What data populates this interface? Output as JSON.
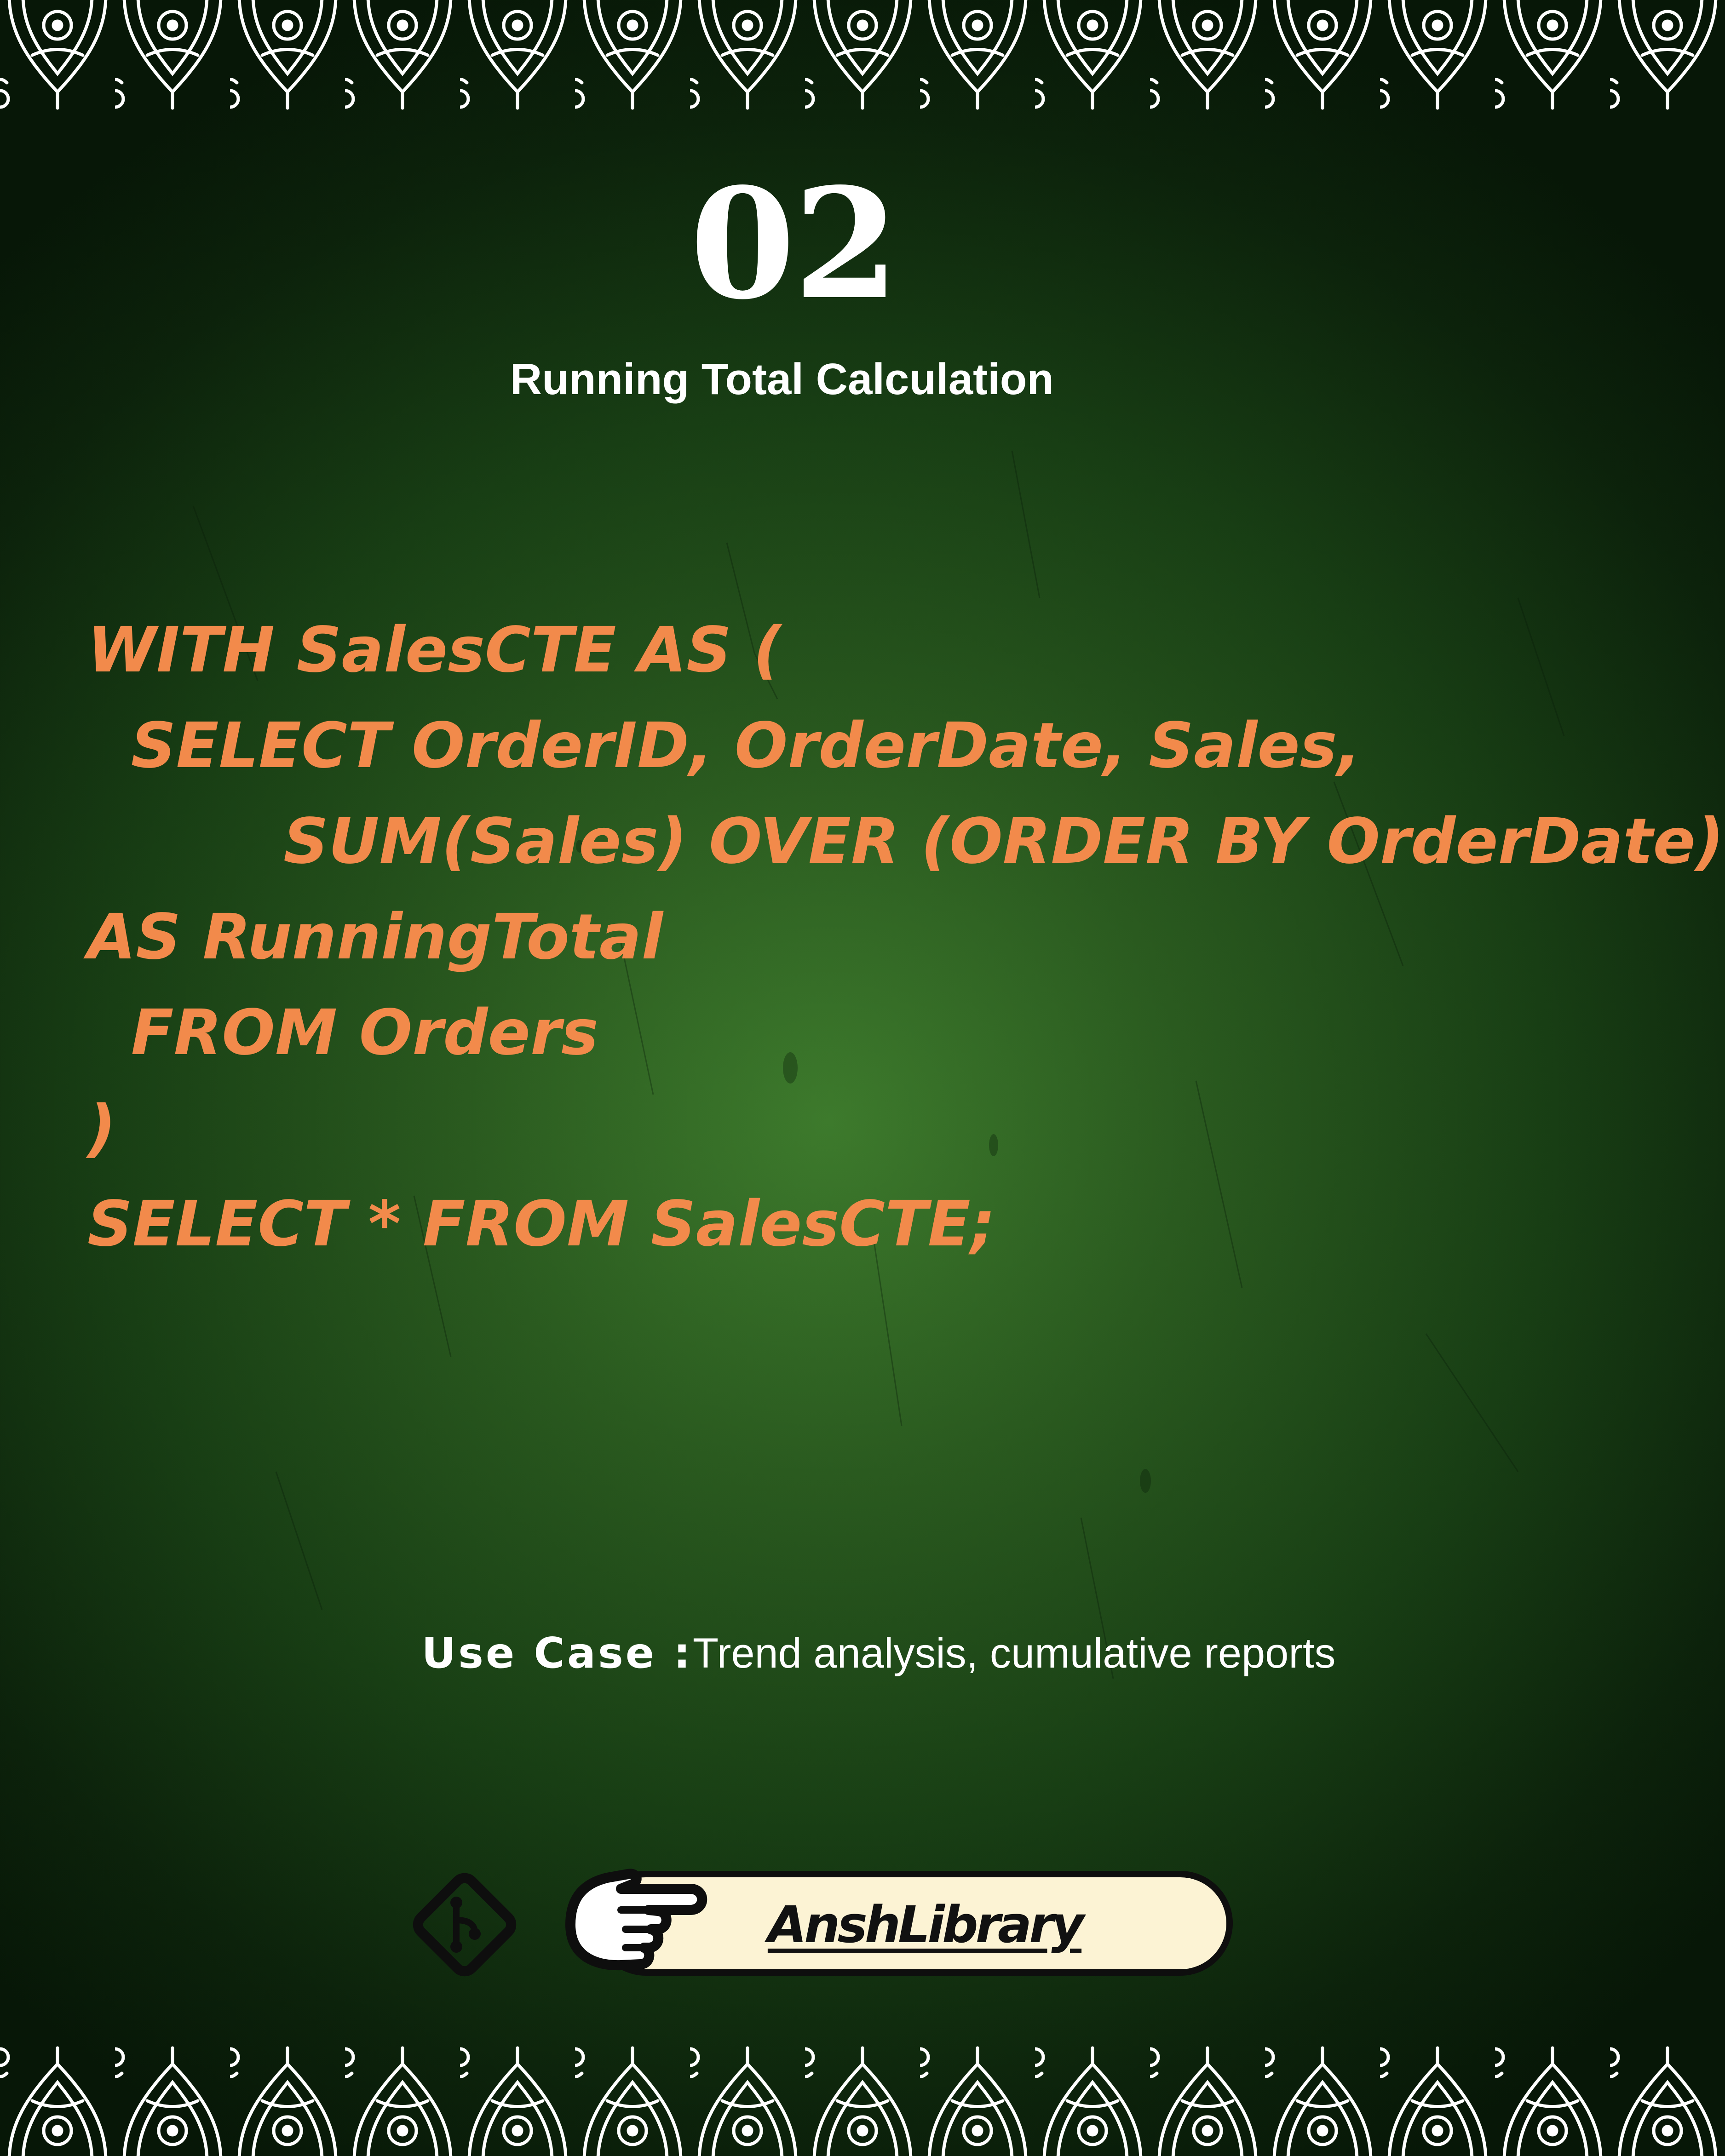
{
  "slide": {
    "number": "02",
    "title": "Running Total Calculation"
  },
  "code": {
    "lines": [
      "WITH SalesCTE AS (",
      "  SELECT OrderID, OrderDate, Sales,",
      "         SUM(Sales) OVER (ORDER BY OrderDate)",
      "AS RunningTotal",
      "  FROM Orders",
      ")",
      "SELECT * FROM SalesCTE;"
    ]
  },
  "use_case": {
    "label": "Use Case :",
    "text": "Trend analysis, cumulative reports"
  },
  "footer": {
    "brand_name": "AnshLibrary",
    "icons": [
      "git-branch-icon",
      "pointing-hand-icon"
    ]
  },
  "colors": {
    "code_text": "#f28a4b",
    "heading_text": "#ffffff",
    "background_dark": "#0c220b",
    "background_light": "#3d7a2c",
    "brand_pill": "#fcf3d4"
  }
}
